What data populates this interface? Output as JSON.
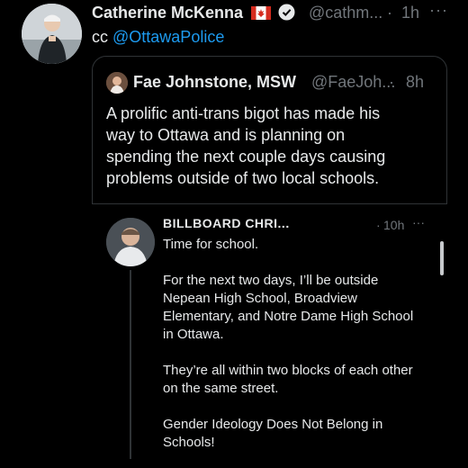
{
  "outer_tweet": {
    "author_name": "Catherine McKenna",
    "flag": "🇨🇦",
    "verified_icon": "verified-badge-icon",
    "handle": "@cathm...",
    "separator": "·",
    "time": "1h",
    "more": "···",
    "text_prefix": "cc",
    "mention": "@OttawaPolice"
  },
  "quoted_tweet": {
    "author_name": "Fae Johnstone, MSW",
    "handle": "@FaeJoh...",
    "separator": "·",
    "time": "8h",
    "text_lines": [
      "A prolific anti-trans bigot has made his",
      "way to Ottawa and is planning on",
      "spending the next couple days causing",
      "problems outside of two local schools."
    ]
  },
  "embedded_screenshot": {
    "author_name": "BILLBOARD CHRI...",
    "separator": "·",
    "time": "10h",
    "more": "···",
    "paragraphs": [
      [
        "Time for school."
      ],
      [
        "For the next two days, I’ll be outside",
        "Nepean High School, Broadview",
        "Elementary, and Notre Dame High School",
        "in Ottawa."
      ],
      [
        "They’re all within two blocks of each other",
        "on the same street."
      ],
      [
        "Gender Ideology Does Not Belong in",
        "Schools!"
      ]
    ]
  },
  "colors": {
    "background": "#000000",
    "text": "#e7e9ea",
    "muted": "#71767b",
    "link": "#1d9bf0",
    "border": "#2f3336"
  }
}
